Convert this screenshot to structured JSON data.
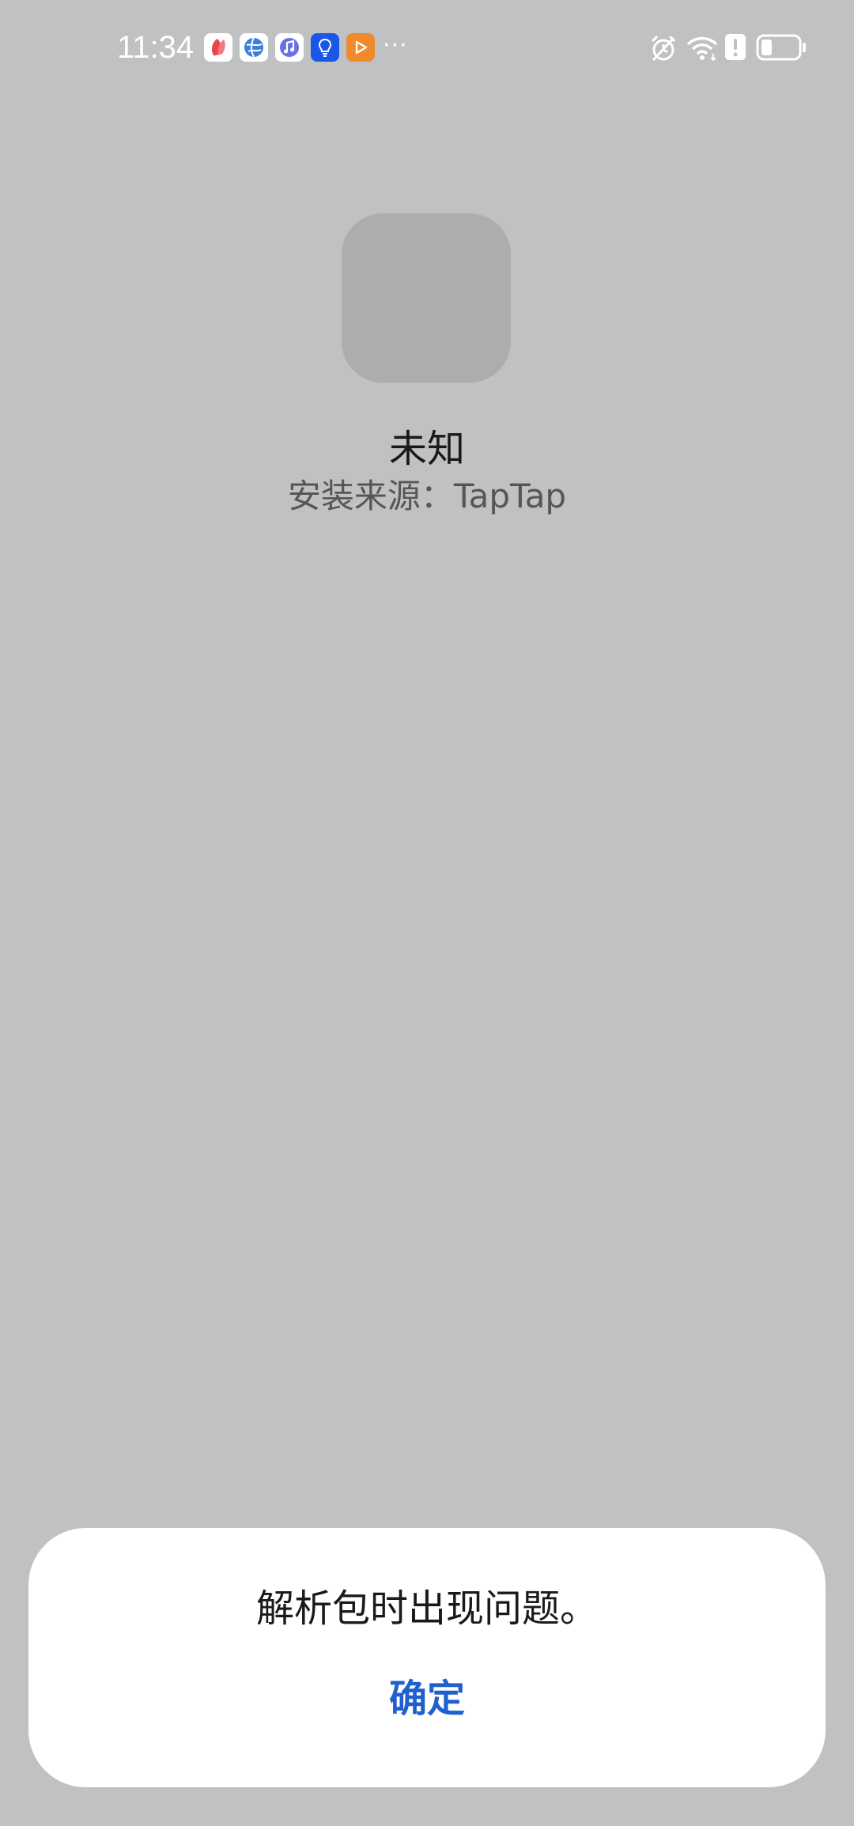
{
  "status_bar": {
    "time": "11:34",
    "more_indicator": "···",
    "notification_icons": [
      "red-petal-app-icon",
      "blue-globe-app-icon",
      "music-app-icon",
      "lightbulb-app-icon",
      "orange-play-app-icon"
    ],
    "system_icons": [
      "alarm-icon",
      "wifi-icon",
      "alert-icon",
      "battery-icon"
    ]
  },
  "app": {
    "name": "未知",
    "install_source": "安装来源：TapTap"
  },
  "dialog": {
    "message": "解析包时出现问题。",
    "confirm_label": "确定"
  },
  "colors": {
    "background": "#c0c1c3",
    "dialog_bg": "#ffffff",
    "accent": "#1f5fcf"
  }
}
